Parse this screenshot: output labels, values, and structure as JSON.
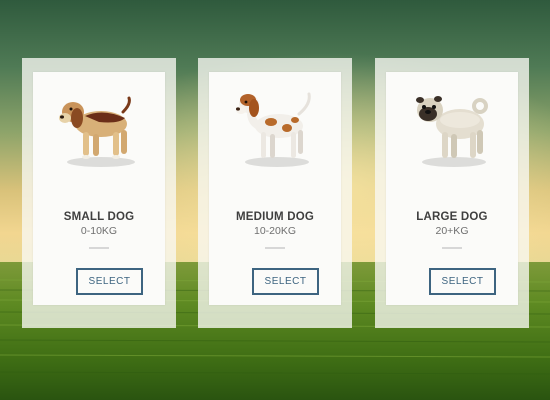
{
  "cards": [
    {
      "title": "SMALL DOG",
      "weight": "0-10KG",
      "button_label": "SELECT"
    },
    {
      "title": "MEDIUM DOG",
      "weight": "10-20KG",
      "button_label": "SELECT"
    },
    {
      "title": "LARGE DOG",
      "weight": "20+KG",
      "button_label": "SELECT"
    }
  ],
  "colors": {
    "button_border": "#3d6480",
    "title_text": "#3f3f3f",
    "weight_text": "#6f6f6f"
  }
}
